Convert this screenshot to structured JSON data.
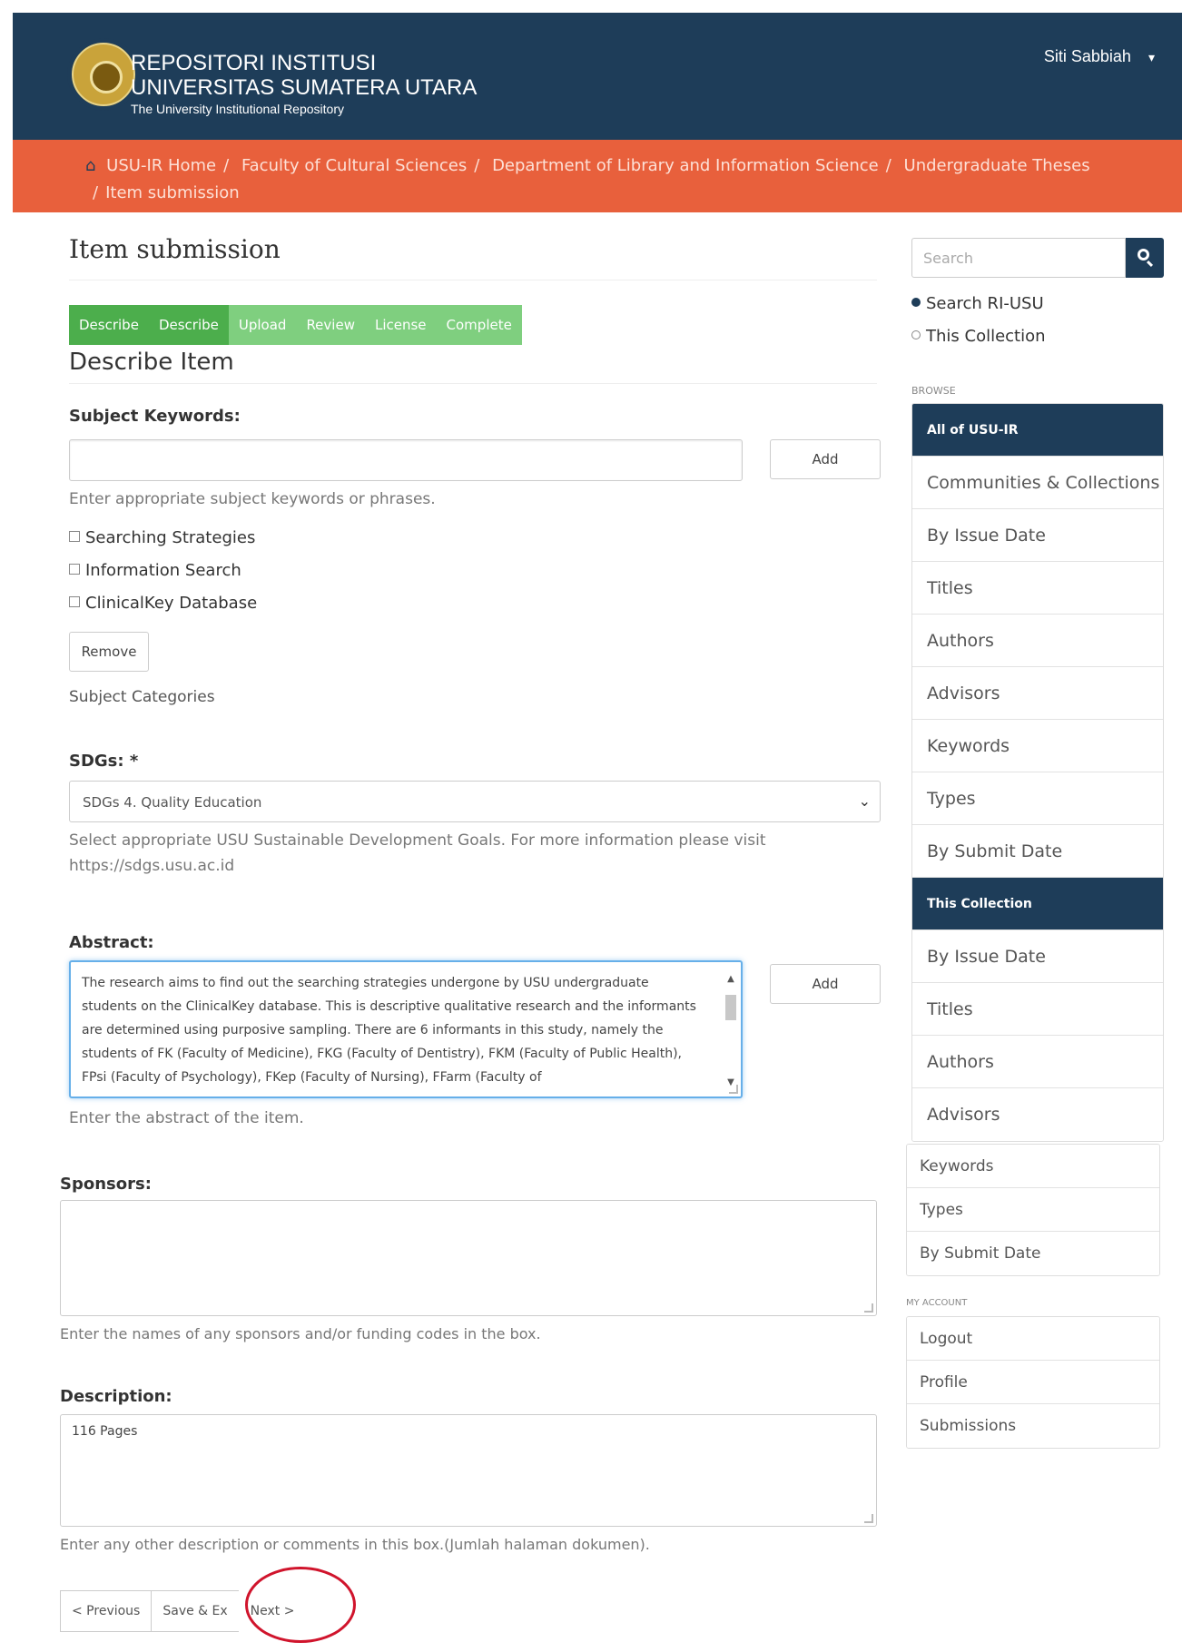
{
  "header": {
    "repo_line1": "REPOSITORI INSTITUSI",
    "repo_line2": "UNIVERSITAS SUMATERA UTARA",
    "repo_subtitle": "The University Institutional Repository",
    "user_name": "Siti Sabbiah"
  },
  "breadcrumb": {
    "items": [
      "USU-IR Home",
      "Faculty of Cultural Sciences",
      "Department of Library and Information Science",
      "Undergraduate Theses",
      "Item submission"
    ]
  },
  "page": {
    "title": "Item submission",
    "steps": [
      "Describe",
      "Describe",
      "Upload",
      "Review",
      "License",
      "Complete"
    ],
    "section_title": "Describe Item"
  },
  "form": {
    "subject_keywords": {
      "label": "Subject Keywords:",
      "add_label": "Add",
      "help": "Enter appropriate subject keywords or phrases.",
      "items": [
        "Searching Strategies",
        "Information Search",
        "ClinicalKey Database"
      ],
      "remove_label": "Remove",
      "categories_text": "Subject Categories"
    },
    "sdgs": {
      "label": "SDGs: *",
      "selected": "SDGs 4. Quality Education",
      "help_line1": "Select appropriate USU Sustainable Development Goals. For more information please visit",
      "help_line2": "https://sdgs.usu.ac.id"
    },
    "abstract": {
      "label": "Abstract:",
      "value": "The research aims to find out the searching strategies undergone by USU undergraduate students on the ClinicalKey database. This is descriptive qualitative research and the informants are determined using purposive sampling. There are 6 informants in this study, namely the students of FK (Faculty of Medicine), FKG (Faculty of Dentistry), FKM (Faculty of Public Health), FPsi (Faculty of Psychology), FKep (Faculty of Nursing), FFarm (Faculty of",
      "add_label": "Add",
      "help": "Enter the abstract of the item."
    },
    "sponsors": {
      "label": "Sponsors:",
      "value": "",
      "help": "Enter the names of any sponsors and/or funding codes in the box."
    },
    "description": {
      "label": "Description:",
      "value": "116 Pages",
      "help": "Enter any other description or comments in this box.(Jumlah halaman dokumen)."
    },
    "buttons": {
      "previous": "< Previous",
      "save_exit": "Save & Ex",
      "next": "Next >"
    }
  },
  "sidebar": {
    "search_placeholder": "Search",
    "scope_options": [
      "Search RI-USU",
      "This Collection"
    ],
    "browse_heading": "BROWSE",
    "all_heading": "All of USU-IR",
    "all_items": [
      "Communities & Collections",
      "By Issue Date",
      "Titles",
      "Authors",
      "Advisors",
      "Keywords",
      "Types",
      "By Submit Date"
    ],
    "collection_heading": "This Collection",
    "collection_items": [
      "By Issue Date",
      "Titles",
      "Authors",
      "Advisors",
      "Keywords",
      "Types",
      "By Submit Date"
    ],
    "account_heading": "MY ACCOUNT",
    "account_items": [
      "Logout",
      "Profile",
      "Submissions"
    ]
  },
  "colors": {
    "header_bg": "#1e3d59",
    "breadcrumb_bg": "#e8603c",
    "step_done": "#4cae4c",
    "step_pending": "#7fcf7f",
    "highlight_circle": "#d0142c"
  }
}
